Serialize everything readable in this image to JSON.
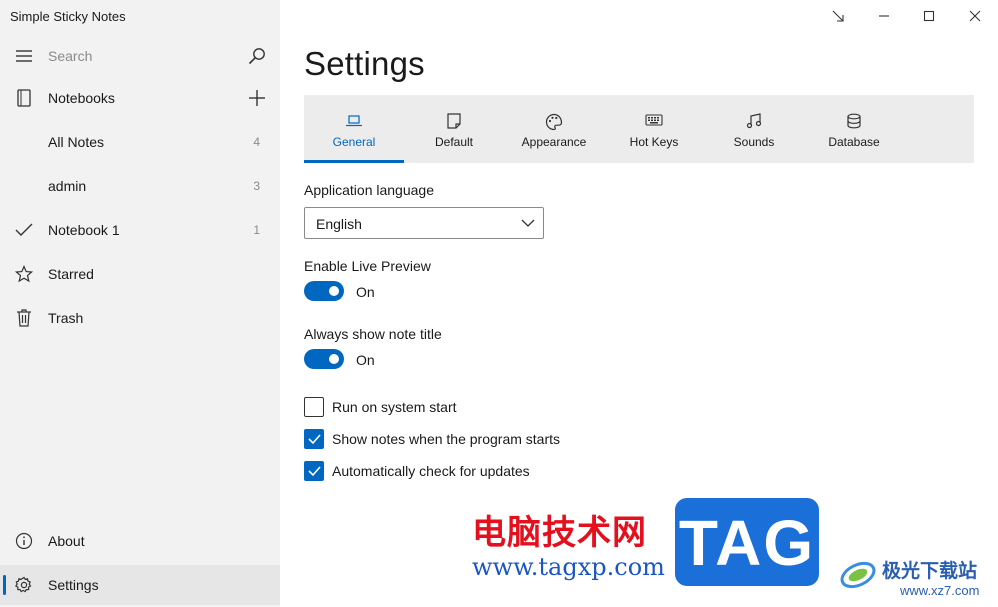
{
  "app": {
    "title": "Simple Sticky Notes"
  },
  "sidebar": {
    "search_placeholder": "Search",
    "notebooks_label": "Notebooks",
    "items": [
      {
        "label": "All Notes",
        "count": "4"
      },
      {
        "label": "admin",
        "count": "3"
      },
      {
        "label": "Notebook 1",
        "count": "1"
      }
    ],
    "starred_label": "Starred",
    "trash_label": "Trash",
    "about_label": "About",
    "settings_label": "Settings"
  },
  "settings": {
    "title": "Settings",
    "tabs": [
      {
        "label": "General",
        "icon": "laptop-icon",
        "active": true
      },
      {
        "label": "Default",
        "icon": "note-icon"
      },
      {
        "label": "Appearance",
        "icon": "palette-icon"
      },
      {
        "label": "Hot Keys",
        "icon": "keyboard-icon"
      },
      {
        "label": "Sounds",
        "icon": "music-icon"
      },
      {
        "label": "Database",
        "icon": "database-icon"
      }
    ],
    "language_label": "Application language",
    "language_value": "English",
    "live_preview_label": "Enable Live Preview",
    "live_preview_state": "On",
    "note_title_label": "Always show note title",
    "note_title_state": "On",
    "checkboxes": [
      {
        "label": "Run on system start",
        "checked": false
      },
      {
        "label": "Show notes when the program starts",
        "checked": true
      },
      {
        "label": "Automatically check for updates",
        "checked": true
      }
    ]
  },
  "watermark": {
    "cn_text": "电脑技术网",
    "url": "www.tagxp.com",
    "tag": "TAG",
    "site_cn": "极光下载站",
    "site_url": "www.xz7.com"
  },
  "colors": {
    "accent": "#0067c0",
    "sidebar_bg": "#f2f2f2",
    "tabbar_bg": "#ececec"
  }
}
